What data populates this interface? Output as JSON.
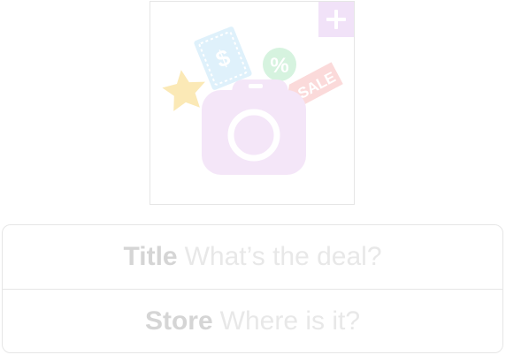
{
  "photo_picker": {
    "ticket_icon_text": "$",
    "percent_badge_text": "%",
    "sale_tag_text": "SALE",
    "colors": {
      "add_badge": "#f1e2f8",
      "camera": "#f4e6f8",
      "ticket": "#dff1fb",
      "percent_badge": "#d6f3df",
      "sale_tag": "#fbdada",
      "star": "#fbe9b6"
    }
  },
  "form": {
    "title": {
      "label": "Title",
      "placeholder": "What’s the deal?"
    },
    "store": {
      "label": "Store",
      "placeholder": "Where is it?"
    }
  }
}
